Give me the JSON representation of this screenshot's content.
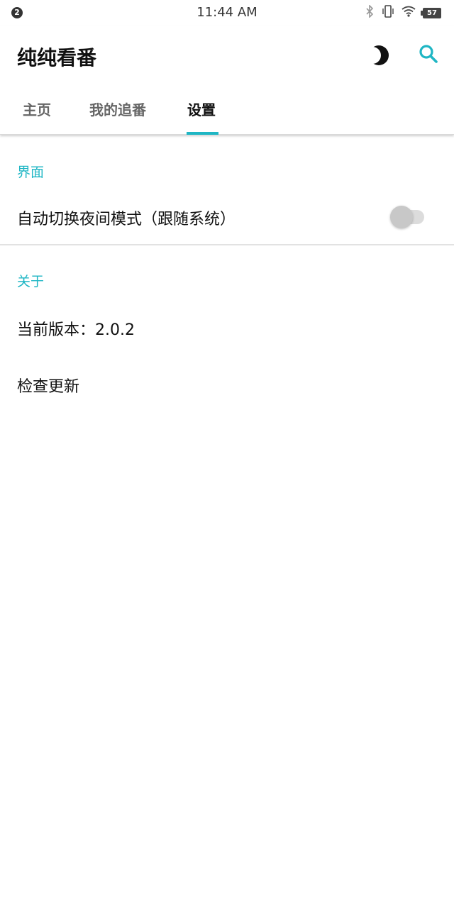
{
  "status_bar": {
    "notification_count": "2",
    "time": "11:44 AM",
    "battery": "57",
    "icons": [
      "bluetooth-icon",
      "vibrate-icon",
      "wifi-icon",
      "battery-icon"
    ]
  },
  "app_bar": {
    "title": "纯纯看番",
    "actions": [
      "night-mode-icon",
      "search-icon"
    ],
    "accent_color": "#1fb6c4"
  },
  "tabs": [
    {
      "label": "主页",
      "active": false
    },
    {
      "label": "我的追番",
      "active": false
    },
    {
      "label": "设置",
      "active": true
    }
  ],
  "settings": {
    "interface": {
      "header": "界面",
      "auto_night_label": "自动切换夜间模式（跟随系统）",
      "auto_night_enabled": false
    },
    "about": {
      "header": "关于",
      "version_label": "当前版本：2.0.2",
      "check_update_label": "检查更新"
    }
  }
}
